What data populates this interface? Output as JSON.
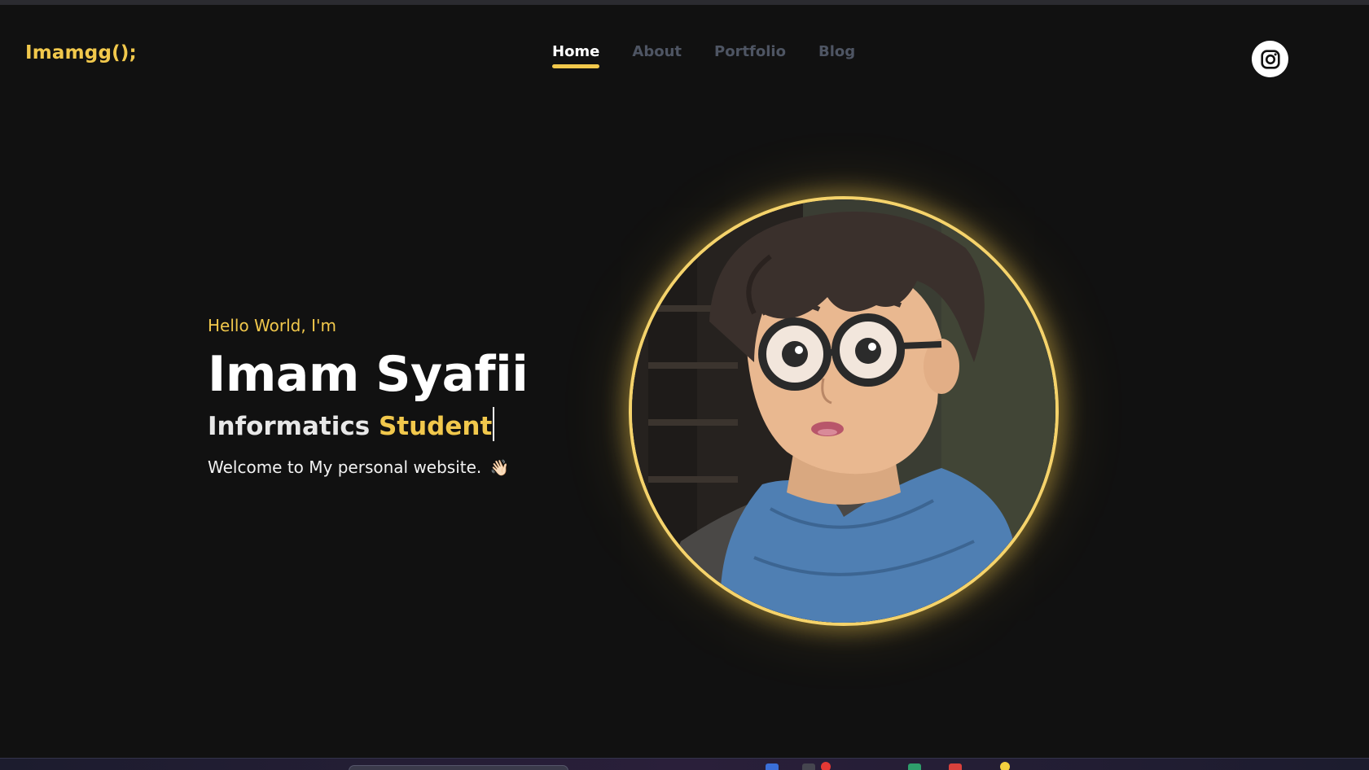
{
  "brand": {
    "label": "Imamgg();"
  },
  "nav": {
    "items": [
      {
        "label": "Home",
        "active": true
      },
      {
        "label": "About",
        "active": false
      },
      {
        "label": "Portfolio",
        "active": false
      },
      {
        "label": "Blog",
        "active": false
      }
    ]
  },
  "social": {
    "icon": "instagram-icon"
  },
  "hero": {
    "greeting": "Hello World, I'm",
    "name": "Imam Syafii",
    "role_word1": "Informatics",
    "role_word2": "Student",
    "welcome": "Welcome to My personal website.",
    "wave": "👋🏻"
  },
  "avatar": {
    "icon": "profile-avatar-illustration"
  },
  "colors": {
    "accent": "#f1c84c",
    "background": "#111111",
    "nav_inactive": "#4e5563",
    "text": "#ffffff"
  }
}
